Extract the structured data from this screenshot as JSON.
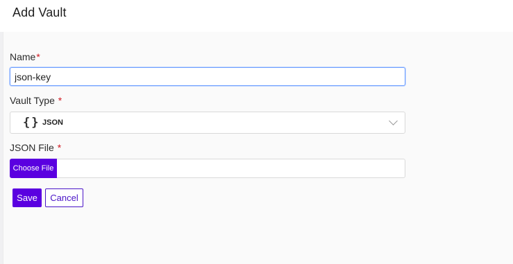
{
  "header": {
    "title": "Add Vault"
  },
  "form": {
    "name": {
      "label": "Name",
      "required_mark": "*",
      "value": "json-key"
    },
    "vault_type": {
      "label": "Vault Type",
      "required_mark": "*",
      "icon": "{}",
      "icon_name": "curly-braces-icon",
      "selected": "JSON"
    },
    "json_file": {
      "label": "JSON File",
      "required_mark": "*",
      "choose_label": "Choose File"
    }
  },
  "actions": {
    "save_label": "Save",
    "cancel_label": "Cancel"
  },
  "colors": {
    "accent": "#5a00e0",
    "required": "#d01820",
    "focus_border": "#6fa0ff"
  }
}
